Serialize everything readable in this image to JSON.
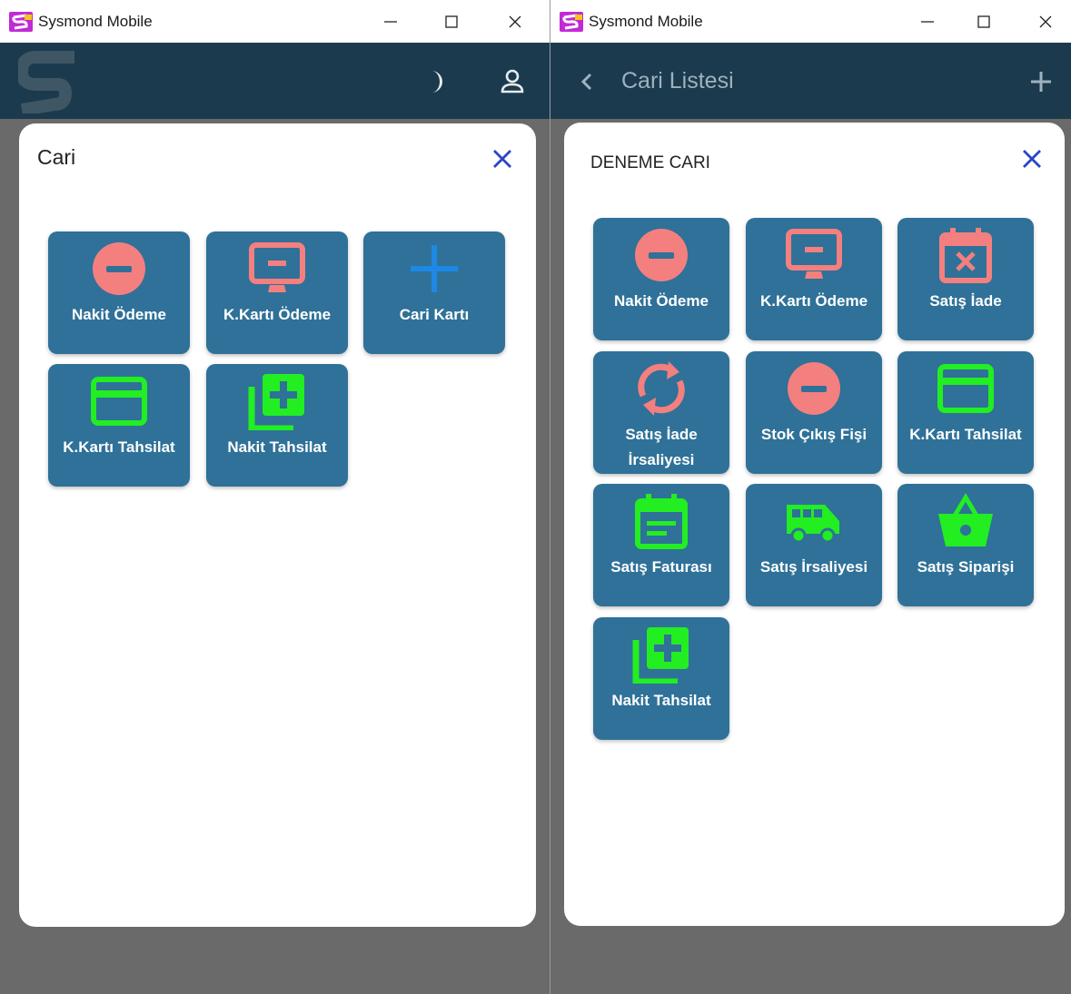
{
  "left_window": {
    "title": "Sysmond Mobile",
    "modal": {
      "title": "Cari",
      "tiles": [
        {
          "label": "Nakit Ödeme",
          "icon": "minus-circle-icon"
        },
        {
          "label": "K.Kartı Ödeme",
          "icon": "monitor-minus-icon"
        },
        {
          "label": "Cari Kartı",
          "icon": "plus-icon"
        },
        {
          "label": "K.Kartı Tahsilat",
          "icon": "credit-card-icon"
        },
        {
          "label": "Nakit Tahsilat",
          "icon": "library-add-icon"
        }
      ]
    }
  },
  "right_window": {
    "title": "Sysmond Mobile",
    "header_title": "Cari Listesi",
    "modal": {
      "title": "DENEME CARI",
      "tiles": [
        {
          "label": "Nakit Ödeme",
          "icon": "minus-circle-icon"
        },
        {
          "label": "K.Kartı Ödeme",
          "icon": "monitor-minus-icon"
        },
        {
          "label": "Satış İade",
          "icon": "calendar-remove-icon"
        },
        {
          "label": "Satış İade İrsaliyesi",
          "icon": "sync-icon"
        },
        {
          "label": "Stok Çıkış Fişi",
          "icon": "minus-circle-icon"
        },
        {
          "label": "K.Kartı Tahsilat",
          "icon": "credit-card-icon"
        },
        {
          "label": "Satış Faturası",
          "icon": "calendar-text-icon"
        },
        {
          "label": "Satış İrsaliyesi",
          "icon": "van-icon"
        },
        {
          "label": "Satış Siparişi",
          "icon": "basket-icon"
        },
        {
          "label": "Nakit Tahsilat",
          "icon": "library-add-icon"
        }
      ]
    }
  },
  "colors": {
    "appbar": "#1b3a4e",
    "tile": "#2f7198",
    "icon_salmon": "#f47f7f",
    "icon_green": "#22ee22",
    "icon_blue": "#1e88e5",
    "close_blue": "#2b45c4",
    "logo_purple": "#c12ad6"
  }
}
